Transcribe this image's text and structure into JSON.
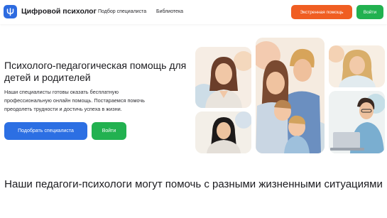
{
  "header": {
    "brand": "Цифровой психолог",
    "nav": [
      "Подбор специалиста",
      "Библиотека"
    ],
    "emergency_button": "Экстренная помощь",
    "login_button": "Войти"
  },
  "hero": {
    "title": "Психолого-педагогическая помощь для детей и родителей",
    "description": "Наши специалисты готовы оказать бесплатную профессиональную онлайн помощь. Постараемся помочь преодолеть трудности и достичь успеха в жизни.",
    "choose_button": "Подобрать специалиста",
    "login_button": "Войти"
  },
  "section": {
    "title": "Наши педагоги-психологи могут помочь с разными жизненными ситуациями"
  },
  "colors": {
    "primary_blue": "#2c6fe3",
    "emergency_orange": "#f05e22",
    "login_green": "#22b150"
  }
}
